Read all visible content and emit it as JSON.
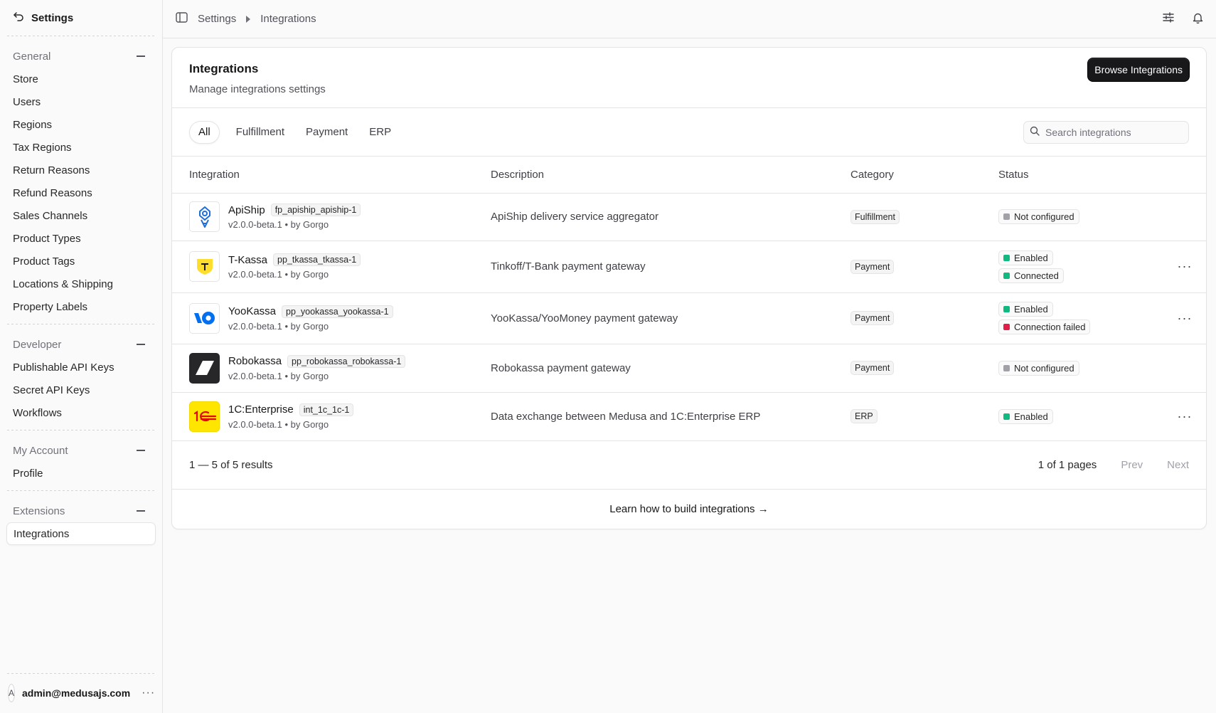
{
  "sidebar": {
    "title": "Settings",
    "groups": [
      {
        "label": "General",
        "items": [
          "Store",
          "Users",
          "Regions",
          "Tax Regions",
          "Return Reasons",
          "Refund Reasons",
          "Sales Channels",
          "Product Types",
          "Product Tags",
          "Locations & Shipping",
          "Property Labels"
        ]
      },
      {
        "label": "Developer",
        "items": [
          "Publishable API Keys",
          "Secret API Keys",
          "Workflows"
        ]
      },
      {
        "label": "My Account",
        "items": [
          "Profile"
        ]
      },
      {
        "label": "Extensions",
        "items": [
          "Integrations"
        ]
      }
    ],
    "active_item": "Integrations",
    "user": {
      "initial": "A",
      "email": "admin@medusajs.com"
    }
  },
  "breadcrumb": [
    "Settings",
    "Integrations"
  ],
  "page": {
    "title": "Integrations",
    "subtitle": "Manage integrations settings",
    "browse_button": "Browse Integrations"
  },
  "tabs": [
    "All",
    "Fulfillment",
    "Payment",
    "ERP"
  ],
  "active_tab": "All",
  "search": {
    "placeholder": "Search integrations",
    "value": ""
  },
  "table": {
    "headers": [
      "Integration",
      "Description",
      "Category",
      "Status"
    ],
    "rows": [
      {
        "name": "ApiShip",
        "code": "fp_apiship_apiship-1",
        "meta": "v2.0.0-beta.1 • by Gorgo",
        "description": "ApiShip delivery service aggregator",
        "category": "Fulfillment",
        "logo": "apiship-logo",
        "statuses": [
          {
            "label": "Not configured",
            "color": "#a1a1aa"
          }
        ],
        "has_actions": false
      },
      {
        "name": "T-Kassa",
        "code": "pp_tkassa_tkassa-1",
        "meta": "v2.0.0-beta.1 • by Gorgo",
        "description": "Tinkoff/T-Bank payment gateway",
        "category": "Payment",
        "logo": "tkassa-logo",
        "statuses": [
          {
            "label": "Enabled",
            "color": "#10b981"
          },
          {
            "label": "Connected",
            "color": "#10b981"
          }
        ],
        "has_actions": true
      },
      {
        "name": "YooKassa",
        "code": "pp_yookassa_yookassa-1",
        "meta": "v2.0.0-beta.1 • by Gorgo",
        "description": "YooKassa/YooMoney payment gateway",
        "category": "Payment",
        "logo": "yookassa-logo",
        "statuses": [
          {
            "label": "Enabled",
            "color": "#10b981"
          },
          {
            "label": "Connection failed",
            "color": "#e11d48"
          }
        ],
        "has_actions": true
      },
      {
        "name": "Robokassa",
        "code": "pp_robokassa_robokassa-1",
        "meta": "v2.0.0-beta.1 • by Gorgo",
        "description": "Robokassa payment gateway",
        "category": "Payment",
        "logo": "robokassa-logo",
        "statuses": [
          {
            "label": "Not configured",
            "color": "#a1a1aa"
          }
        ],
        "has_actions": false
      },
      {
        "name": "1C:Enterprise",
        "code": "int_1c_1c-1",
        "meta": "v2.0.0-beta.1 • by Gorgo",
        "description": "Data exchange between Medusa and 1C:Enterprise ERP",
        "category": "ERP",
        "logo": "1c-logo",
        "statuses": [
          {
            "label": "Enabled",
            "color": "#10b981"
          }
        ],
        "has_actions": true
      }
    ]
  },
  "pagination": {
    "results": "1 — 5 of 5 results",
    "pages": "1 of 1 pages",
    "prev": "Prev",
    "next": "Next"
  },
  "footer_link": "Learn how to build integrations →",
  "colors": {
    "accent_dark": "#18181b",
    "success": "#10b981",
    "error": "#e11d48",
    "neutral": "#a1a1aa",
    "tkassa_yellow": "#ffdd2d",
    "yookassa_blue": "#0070f0",
    "onec_yellow": "#ffe600",
    "onec_red": "#e30613"
  }
}
